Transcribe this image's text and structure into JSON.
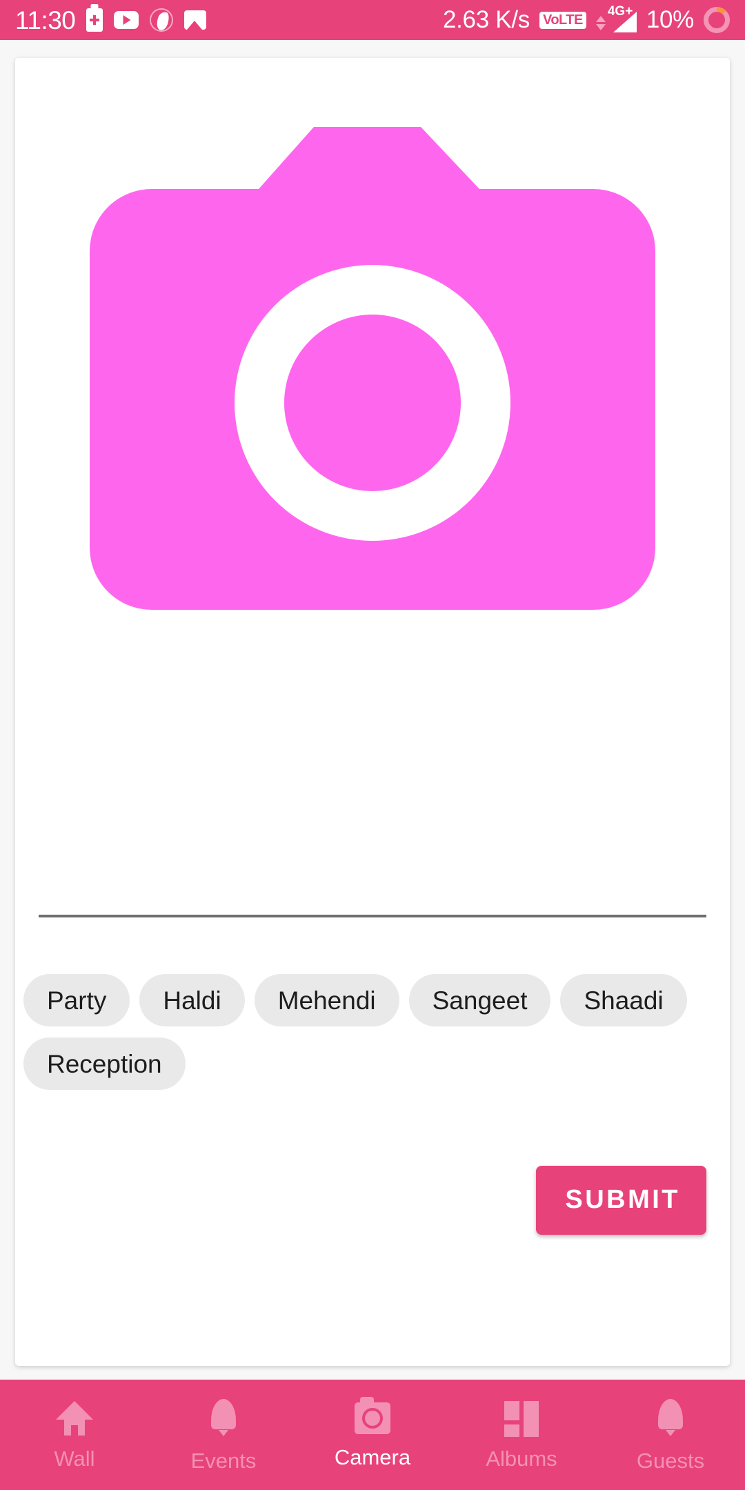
{
  "colors": {
    "brand_pink": "#e8427a",
    "camera_magenta": "#ff66ee",
    "chip_bg": "#e9e9e9",
    "nav_inactive": "#f391b4",
    "nav_active": "#ffffff",
    "divider": "#6d6e71"
  },
  "status_bar": {
    "clock": "11:30",
    "network_speed": "2.63 K/s",
    "volte_label": "VoLTE",
    "network_type": "4G+",
    "battery_percent": "10%",
    "left_icons": [
      "battery-charging-icon",
      "youtube-icon",
      "opera-icon",
      "gallery-icon"
    ],
    "right_icons": [
      "volte-badge-icon",
      "data-transfer-arrows-icon",
      "signal-strength-icon",
      "battery-ring-icon"
    ]
  },
  "main": {
    "photo_placeholder_icon": "camera-icon",
    "chips": [
      {
        "label": "Party"
      },
      {
        "label": "Haldi"
      },
      {
        "label": "Mehendi"
      },
      {
        "label": "Sangeet"
      },
      {
        "label": "Shaadi"
      },
      {
        "label": "Reception"
      }
    ],
    "submit_label": "SUBMIT"
  },
  "bottom_nav": {
    "items": [
      {
        "label": "Wall",
        "icon": "home-icon",
        "active": false
      },
      {
        "label": "Events",
        "icon": "bell-icon",
        "active": false
      },
      {
        "label": "Camera",
        "icon": "camera-icon",
        "active": true
      },
      {
        "label": "Albums",
        "icon": "grid-icon",
        "active": false
      },
      {
        "label": "Guests",
        "icon": "bell-icon",
        "active": false
      }
    ]
  }
}
